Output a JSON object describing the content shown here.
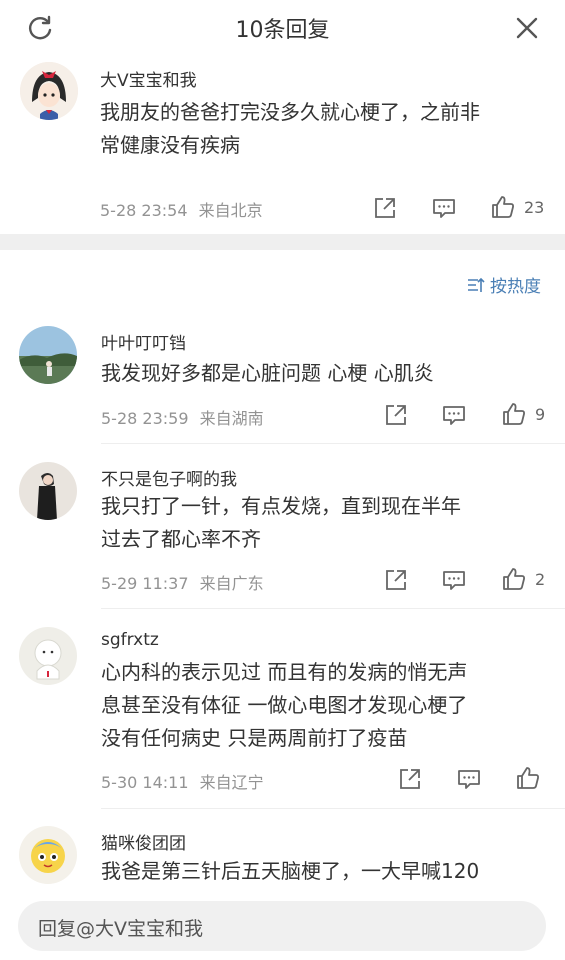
{
  "header": {
    "title": "10条回复"
  },
  "root_comment": {
    "username": "大V宝宝和我",
    "content_lines": [
      "我朋友的爸爸打完没多久就心梗了，之前非",
      "常健康没有疾病"
    ],
    "date": "5-28 23:54",
    "location": "来自北京",
    "likes": "23"
  },
  "sort": {
    "label": "按热度"
  },
  "replies": [
    {
      "username": "叶叶叮叮铛",
      "content_lines": [
        "我发现好多都是心脏问题 心梗 心肌炎"
      ],
      "date": "5-28 23:59",
      "location": "来自湖南",
      "likes": "9"
    },
    {
      "username": "不只是包子啊的我",
      "content_lines": [
        "我只打了一针，有点发烧，直到现在半年",
        "过去了都心率不齐"
      ],
      "date": "5-29 11:37",
      "location": "来自广东",
      "likes": "2"
    },
    {
      "username": "sgfrxtz",
      "content_lines": [
        "心内科的表示见过 而且有的发病的悄无声",
        "息甚至没有体征 一做心电图才发现心梗了",
        "没有任何病史 只是两周前打了疫苗"
      ],
      "date": "5-30 14:11",
      "location": "来自辽宁",
      "likes": ""
    },
    {
      "username": "猫咪俊团团",
      "content_lines": [
        "我爸是第三针后五天脑梗了，一大早喊120"
      ]
    }
  ],
  "reply_input": {
    "placeholder": "回复@大V宝宝和我"
  },
  "icons": [
    "refresh-icon",
    "close-icon",
    "share-icon",
    "comment-icon",
    "like-icon",
    "sort-icon"
  ],
  "colors": {
    "accent": "#4a7fb5",
    "meta": "#939393",
    "divider": "#efefef"
  }
}
